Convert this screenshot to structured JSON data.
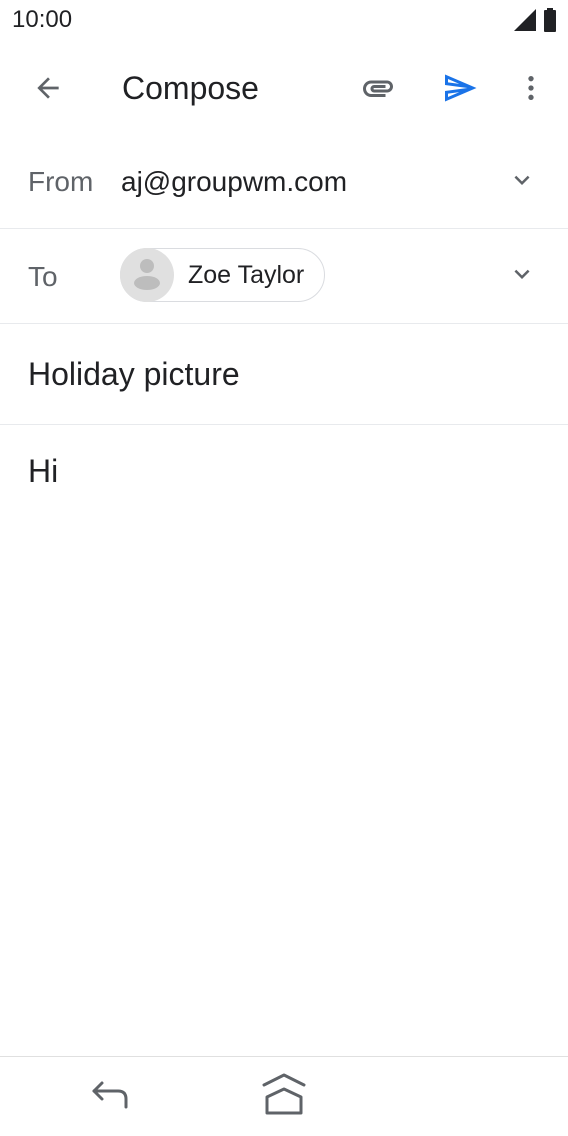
{
  "status_bar": {
    "time": "10:00",
    "icons": [
      "signal-icon",
      "battery-icon"
    ]
  },
  "app_bar": {
    "title": "Compose",
    "icons": {
      "back": "arrow-back-icon",
      "attach": "paperclip-icon",
      "send": "send-icon",
      "more": "more-vert-icon"
    },
    "send_color": "#1a73e8"
  },
  "from": {
    "label": "From",
    "value": "aj@groupwm.com"
  },
  "to": {
    "label": "To",
    "recipient": "Zoe Taylor"
  },
  "subject": {
    "value": "Holiday picture"
  },
  "body": {
    "value": "Hi"
  },
  "nav_bar": {
    "icons": [
      "nav-back-icon",
      "nav-home-icon"
    ]
  }
}
